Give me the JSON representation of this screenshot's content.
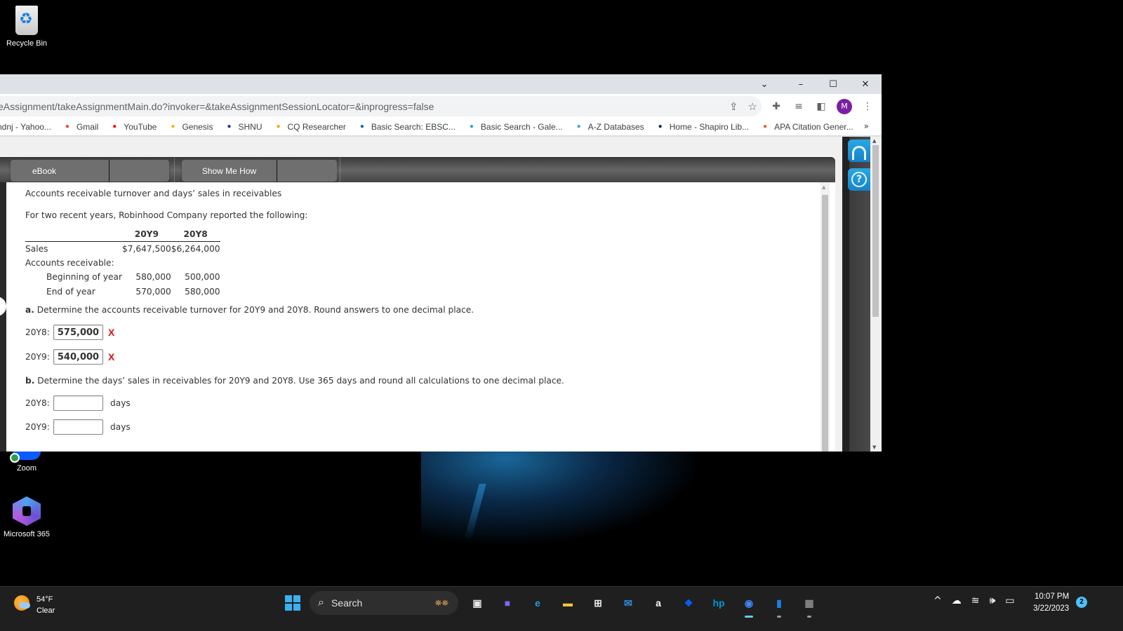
{
  "desktop": {
    "icons": [
      {
        "label": "Recycle Bin",
        "icon": "recycle-bin-icon"
      },
      {
        "label": "Zoom",
        "icon": "zoom-app-icon"
      },
      {
        "label": "Microsoft 365",
        "icon": "microsoft-365-icon"
      }
    ]
  },
  "browser": {
    "window_controls": {
      "tab_search": "⌄",
      "minimize": "–",
      "maximize": "☐",
      "close": "✕"
    },
    "url": "eAssignment/takeAssignmentMain.do?invoker=&takeAssignmentSessionLocator=&inprogress=false",
    "profile_initial": "M",
    "bookmarks": [
      {
        "label": "ndnj - Yahoo...",
        "icon": "yahoo-icon",
        "color": "#6001d2"
      },
      {
        "label": "Gmail",
        "icon": "gmail-icon",
        "color": "#ea4335"
      },
      {
        "label": "YouTube",
        "icon": "youtube-icon",
        "color": "#ff0000"
      },
      {
        "label": "Genesis",
        "icon": "genesis-icon",
        "color": "#f4b400"
      },
      {
        "label": "SHNU",
        "icon": "shnu-feather-icon",
        "color": "#1a3a8a"
      },
      {
        "label": "CQ Researcher",
        "icon": "cq-researcher-icon",
        "color": "#f2a900"
      },
      {
        "label": "Basic Search: EBSC...",
        "icon": "ebsco-icon",
        "color": "#1565c0"
      },
      {
        "label": "Basic Search - Gale...",
        "icon": "gale-icon",
        "color": "#2a9fd6"
      },
      {
        "label": "A-Z Databases",
        "icon": "cloud-icon",
        "color": "#4a9fd8"
      },
      {
        "label": "Home - Shapiro Lib...",
        "icon": "shield-icon",
        "color": "#0d2a6b"
      },
      {
        "label": "APA Citation Gener...",
        "icon": "graduation-cap-icon",
        "color": "#f05a28"
      }
    ],
    "bookmarks_overflow": "»"
  },
  "assignment": {
    "tabs": [
      {
        "label": "eBook"
      },
      {
        "label": "Show Me How"
      }
    ],
    "question_title": "Accounts receivable turnover and days’ sales in receivables",
    "intro": "For two recent years, Robinhood Company reported the following:",
    "table": {
      "headers": [
        "",
        "20Y9",
        "20Y8"
      ],
      "rows": [
        {
          "label": "Sales",
          "y9": "$7,647,500",
          "y8": "$6,264,000",
          "indent": false
        },
        {
          "label": "Accounts receivable:",
          "y9": "",
          "y8": "",
          "indent": false
        },
        {
          "label": "Beginning of year",
          "y9": "580,000",
          "y8": "500,000",
          "indent": true
        },
        {
          "label": "End of year",
          "y9": "570,000",
          "y8": "580,000",
          "indent": true
        }
      ]
    },
    "part_a": {
      "prefix": "a.",
      "text": " Determine the accounts receivable turnover for 20Y9 and 20Y8. Round answers to one decimal place.",
      "answers": [
        {
          "label": "20Y8:",
          "value": "575,000",
          "status": "X"
        },
        {
          "label": "20Y9:",
          "value": "540,000",
          "status": "X"
        }
      ]
    },
    "part_b": {
      "prefix": "b.",
      "text": " Determine the days’ sales in receivables for 20Y9 and 20Y8. Use 365 days and round all calculations to one decimal place.",
      "answers": [
        {
          "label": "20Y8:",
          "value": "",
          "unit": "days"
        },
        {
          "label": "20Y9:",
          "value": "",
          "unit": "days"
        }
      ]
    },
    "status_color": "#e01010"
  },
  "taskbar": {
    "weather": {
      "temp": "54°F",
      "condition": "Clear"
    },
    "search_placeholder": "Search",
    "apps": [
      {
        "name": "task-view",
        "glyph": "▣",
        "color": "#e6e6e6"
      },
      {
        "name": "zoom-meetings",
        "glyph": "■",
        "color": "#7b68ee"
      },
      {
        "name": "edge",
        "glyph": "e",
        "color": "#1fa0e0"
      },
      {
        "name": "file-explorer",
        "glyph": "▬",
        "color": "#f8c33a"
      },
      {
        "name": "microsoft-store",
        "glyph": "⊞",
        "color": "#e8e8e8"
      },
      {
        "name": "mail",
        "glyph": "✉",
        "color": "#2a8be0"
      },
      {
        "name": "amazon",
        "glyph": "a",
        "color": "#ffffff"
      },
      {
        "name": "dropbox",
        "glyph": "❖",
        "color": "#0061fe"
      },
      {
        "name": "myhp",
        "glyph": "hp",
        "color": "#0096d6"
      },
      {
        "name": "chrome",
        "glyph": "◉",
        "color": "#4285f4"
      },
      {
        "name": "windows-app",
        "glyph": "▮",
        "color": "#1f7de0"
      },
      {
        "name": "calculator",
        "glyph": "▦",
        "color": "#888888"
      }
    ],
    "tray": {
      "chevron": "^",
      "onedrive": "☁",
      "wifi": "≋",
      "volume": "🕪",
      "battery": "▭"
    },
    "clock": {
      "time": "10:07 PM",
      "date": "3/22/2023"
    },
    "notifications": "2"
  }
}
